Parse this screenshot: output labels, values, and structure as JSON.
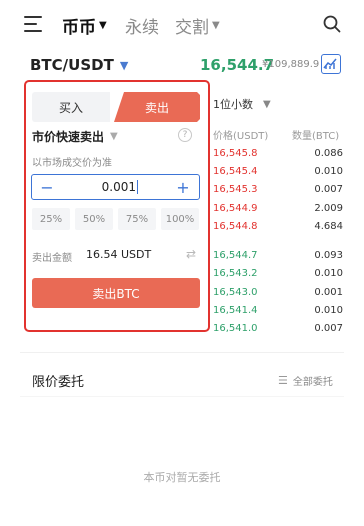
{
  "nav": {
    "tabs": [
      {
        "label": "币币",
        "active": true,
        "caret": "▼"
      },
      {
        "label": "永续",
        "active": false
      },
      {
        "label": "交割",
        "active": false,
        "caret": "▼"
      }
    ],
    "icons": [
      "menu-icon",
      "search-icon"
    ]
  },
  "pair": {
    "symbol": "BTC/USDT",
    "last_price": "16,544.7",
    "cny_price": "¥109,889.9",
    "price_color": "#2ea06a"
  },
  "trade": {
    "buy_label": "买入",
    "sell_label": "卖出",
    "order_type": "市价快速卖出",
    "help": "?",
    "hint": "以市场成交价为准",
    "quantity": "0.001",
    "minus": "−",
    "plus": "+",
    "percent_options": [
      "25%",
      "50%",
      "75%",
      "100%"
    ],
    "amount_label": "卖出金额",
    "amount_value": "16.54 USDT",
    "submit_label": "卖出BTC",
    "accent_color": "#e96a55",
    "highlight_color": "#e2332f"
  },
  "orderbook": {
    "precision": "1位小数",
    "headers": {
      "price": "价格(USDT)",
      "qty": "数量(BTC)"
    },
    "asks": [
      {
        "price": "16,545.8",
        "qty": "0.086"
      },
      {
        "price": "16,545.4",
        "qty": "0.010"
      },
      {
        "price": "16,545.3",
        "qty": "0.007"
      },
      {
        "price": "16,544.9",
        "qty": "2.009"
      },
      {
        "price": "16,544.8",
        "qty": "4.684"
      }
    ],
    "bids": [
      {
        "price": "16,544.7",
        "qty": "0.093"
      },
      {
        "price": "16,543.2",
        "qty": "0.010"
      },
      {
        "price": "16,543.0",
        "qty": "0.001"
      },
      {
        "price": "16,541.4",
        "qty": "0.010"
      },
      {
        "price": "16,541.0",
        "qty": "0.007"
      }
    ],
    "ask_color": "#e2332f",
    "bid_color": "#2ea06a"
  },
  "orders": {
    "title": "限价委托",
    "all_label": "全部委托",
    "empty_text": "本币对暂无委托"
  }
}
